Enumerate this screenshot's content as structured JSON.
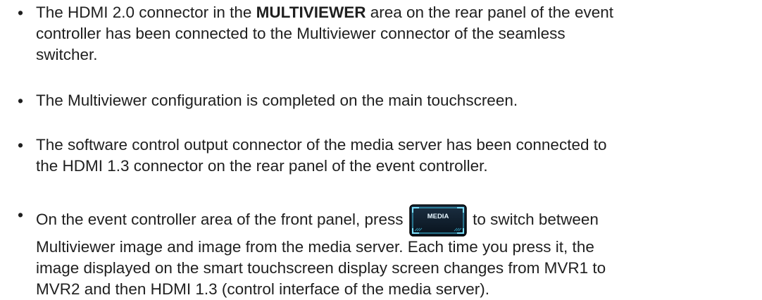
{
  "bullets": [
    {
      "lines": [
        {
          "pre": "The HDMI 2.0 connector in the ",
          "bold": "MULTIVIEWER",
          "post": " area on the rear panel of the event"
        },
        {
          "text": "controller has been connected to the Multiviewer connector of the seamless"
        },
        {
          "text": "switcher."
        }
      ]
    },
    {
      "lines": [
        {
          "text": "The Multiviewer configuration is completed on the main touchscreen."
        }
      ]
    },
    {
      "lines": [
        {
          "text": "The software control output connector of the media server has been connected to"
        },
        {
          "text": "the HDMI 1.3 connector on the rear panel of the event controller."
        }
      ]
    },
    {
      "lines": [
        {
          "pre": "On the event controller area of the front panel, press ",
          "post": " to switch between"
        },
        {
          "text": "Multiviewer image and image from the media server. Each time you press it, the"
        },
        {
          "text": "image displayed on the smart touchscreen display screen changes from MVR1 to"
        },
        {
          "text": "MVR2 and then HDMI 1.3 (control interface of the media server)."
        }
      ]
    }
  ],
  "bullet_glyph": "•",
  "media_button": {
    "label": "MEDIA",
    "icon": "media-button-icon",
    "accent": "#3fc6e8",
    "bg": "#0d1a26"
  }
}
